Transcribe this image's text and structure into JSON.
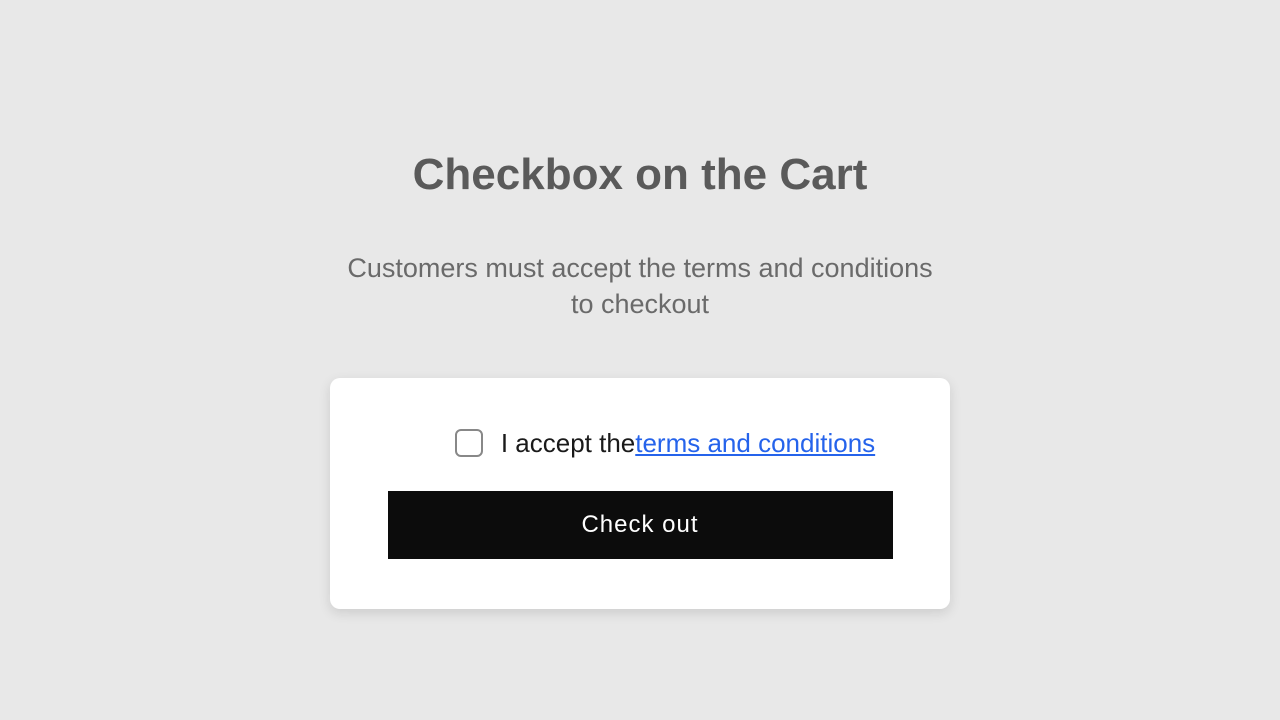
{
  "header": {
    "title": "Checkbox on the Cart",
    "subtitle": "Customers must accept the terms and conditions to checkout"
  },
  "card": {
    "accept_prefix": "I accept the ",
    "terms_link_label": "terms and conditions",
    "checkout_button_label": "Check out"
  }
}
